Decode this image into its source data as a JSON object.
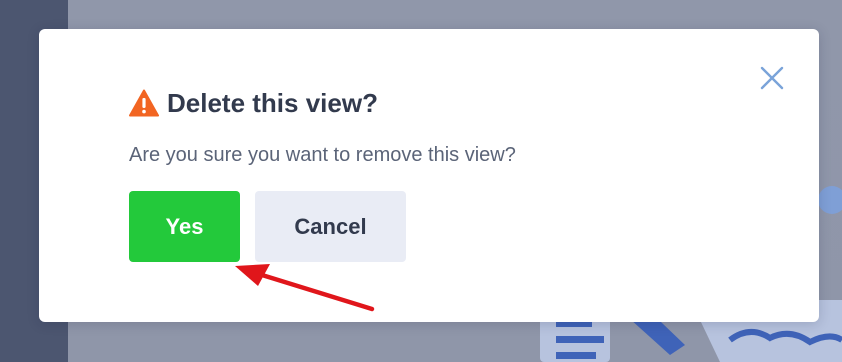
{
  "dialog": {
    "title": "Delete this view?",
    "message": "Are you sure you want to remove this view?",
    "confirm_label": "Yes",
    "cancel_label": "Cancel"
  },
  "icons": {
    "title_icon": "warning-icon",
    "close_icon": "close-icon"
  },
  "colors": {
    "confirm_button": "#23c93b",
    "cancel_button": "#e9ecf5",
    "warning_icon": "#f26522",
    "close_icon": "#7aa3d9",
    "annotation_arrow": "#e0161b"
  }
}
